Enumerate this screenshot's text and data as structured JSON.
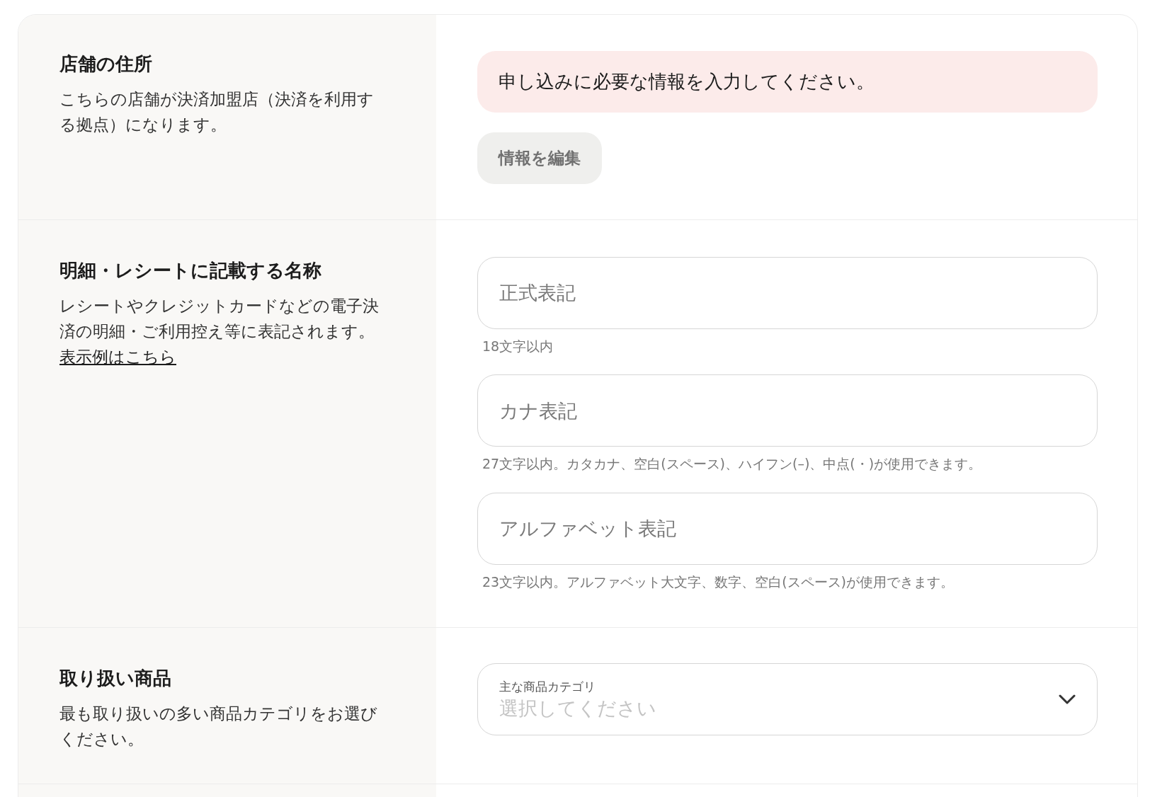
{
  "sections": [
    {
      "kind": "address",
      "title": "店舗の住所",
      "description": "こちらの店舗が決済加盟店（決済を利用する拠点）になります。",
      "alert": "申し込みに必要な情報を入力してください。",
      "button": "情報を編集"
    },
    {
      "kind": "name",
      "title": "明細・レシートに記載する名称",
      "description": "レシートやクレジットカードなどの電子決済の明細・ご利用控え等に表記されます。",
      "link": "表示例はこちら",
      "fields": [
        {
          "placeholder": "正式表記",
          "hint": "18文字以内"
        },
        {
          "placeholder": "カナ表記",
          "hint": "27文字以内。カタカナ、空白(スペース)、ハイフン(–)、中点(・)が使用できます。"
        },
        {
          "placeholder": "アルファベット表記",
          "hint": "23文字以内。アルファベット大文字、数字、空白(スペース)が使用できます。"
        }
      ]
    },
    {
      "kind": "products",
      "title": "取り扱い商品",
      "description": "最も取り扱いの多い商品カテゴリをお選びください。",
      "select": {
        "label": "主な商品カテゴリ",
        "placeholder": "選択してください"
      }
    }
  ]
}
